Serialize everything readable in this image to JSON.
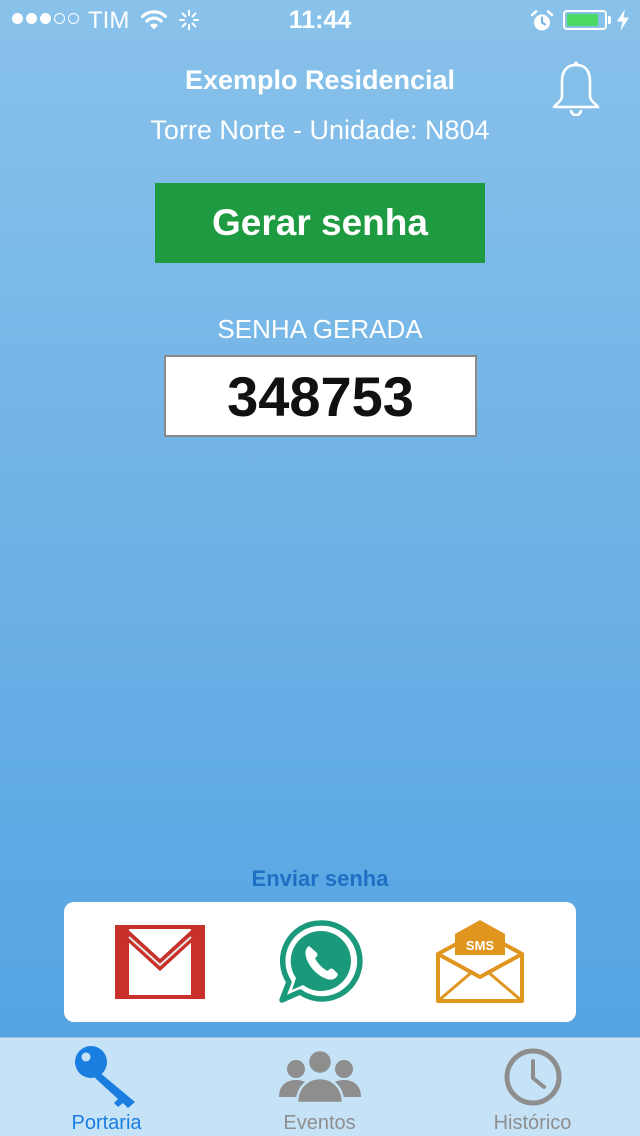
{
  "status_bar": {
    "carrier": "TIM",
    "time": "11:44",
    "signal_bars_filled": 3,
    "signal_bars_total": 5,
    "battery_level": 0.85,
    "icons": [
      "wifi-icon",
      "activity-spinner-icon",
      "alarm-clock-icon",
      "battery-icon",
      "charging-bolt-icon"
    ]
  },
  "header": {
    "title": "Exemplo Residencial",
    "subtitle": "Torre Norte - Unidade: N804",
    "notification_icon": "bell-icon"
  },
  "main": {
    "generate_button_label": "Gerar senha",
    "password_label": "SENHA GERADA",
    "password_value": "348753"
  },
  "share": {
    "label": "Enviar senha",
    "options": [
      {
        "id": "gmail",
        "icon": "gmail-icon"
      },
      {
        "id": "whatsapp",
        "icon": "whatsapp-icon"
      },
      {
        "id": "sms",
        "icon": "sms-envelope-icon",
        "badge_text": "SMS"
      }
    ]
  },
  "tab_bar": {
    "tabs": [
      {
        "label": "Portaria",
        "icon": "key-icon",
        "active": true
      },
      {
        "label": "Eventos",
        "icon": "people-group-icon",
        "active": false
      },
      {
        "label": "Histórico",
        "icon": "clock-icon",
        "active": false
      }
    ]
  },
  "colors": {
    "background_top": "#89c2ea",
    "background_bottom": "#50a2e2",
    "generate_button": "#1e9a40",
    "tab_active": "#1a7ee0",
    "tab_inactive": "#8e8e8e",
    "send_label": "#1f6fc2",
    "battery_fill": "#4cd964"
  }
}
